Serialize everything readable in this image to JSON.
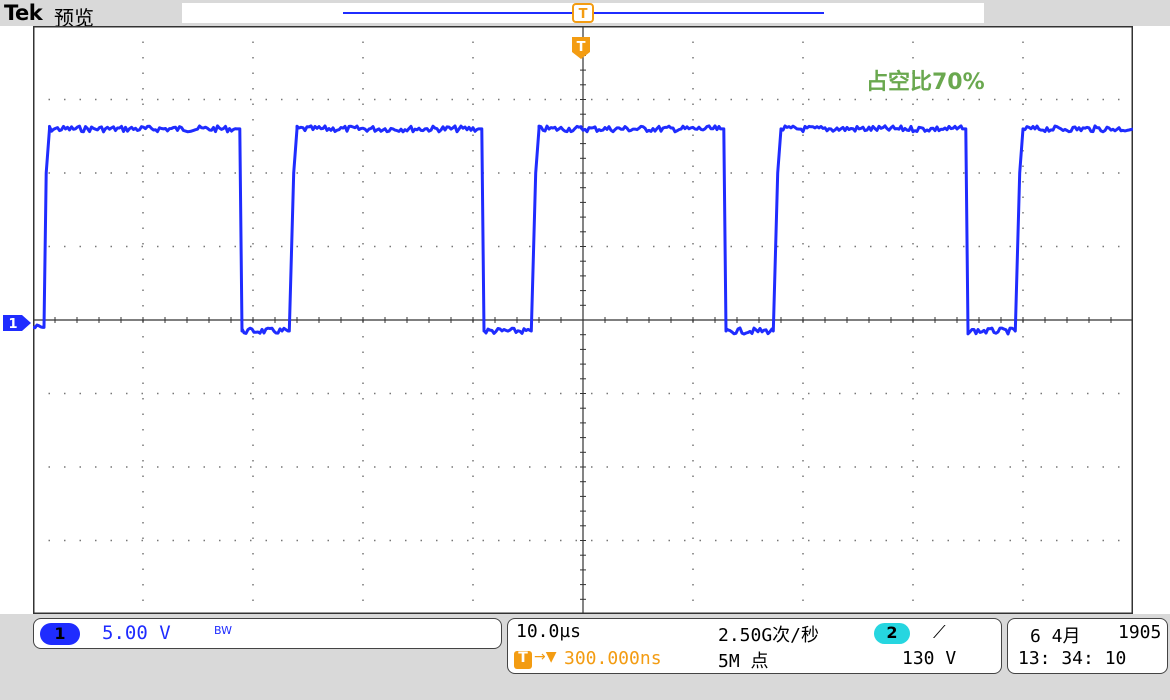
{
  "header": {
    "brand": "Tek",
    "mode": "预览"
  },
  "annotation": "占空比70%",
  "markers": {
    "ch1": "1",
    "trigger": "T"
  },
  "channel1": {
    "badge": "1",
    "scale": "5.00 V",
    "bandwidth": "BW",
    "color": "#1f2cff"
  },
  "timebase": {
    "scale": "10.0µs",
    "sample_rate": "2.50G次/秒",
    "record_length": "5M 点",
    "trigger_delay": "300.000ns",
    "trigger_delay_icon": "T"
  },
  "trigger": {
    "source_badge": "2",
    "source_color": "#26d6e0",
    "edge_icon": "rising-edge-icon",
    "edge_glyph": "⟋",
    "level": "130 V",
    "marker_color": "#f39c12"
  },
  "datetime": {
    "date": "6 4月",
    "count": "1905",
    "time": "13: 34: 10"
  },
  "chart_data": {
    "type": "line",
    "title": "",
    "xlabel": "",
    "ylabel": "",
    "grid": true,
    "divisions": {
      "x": 10,
      "y": 8
    },
    "x_units": "div",
    "y_units": "div",
    "series": [
      {
        "color": "#1f2cff",
        "x": [
          0,
          0.1,
          0.12,
          0.15,
          1.85,
          1.88,
          1.9,
          2.33,
          2.37,
          2.4,
          4.05,
          4.08,
          4.1,
          4.53,
          4.57,
          4.6,
          6.25,
          6.28,
          6.3,
          6.73,
          6.77,
          6.8,
          8.45,
          8.48,
          8.5,
          8.93,
          8.97,
          9.0,
          10.0
        ],
        "y": [
          -0.1,
          -0.1,
          2.0,
          2.6,
          2.6,
          2.6,
          -0.15,
          -0.15,
          2.0,
          2.6,
          2.6,
          2.6,
          -0.15,
          -0.15,
          2.0,
          2.6,
          2.6,
          2.6,
          -0.15,
          -0.15,
          2.0,
          2.6,
          2.6,
          2.6,
          -0.15,
          -0.15,
          2.0,
          2.6,
          2.6
        ]
      }
    ]
  }
}
